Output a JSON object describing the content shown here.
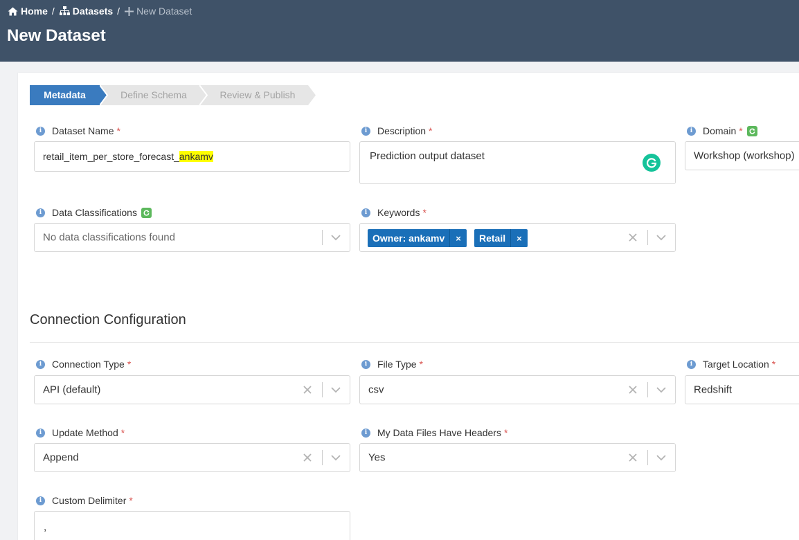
{
  "breadcrumb": {
    "home": "Home",
    "datasets": "Datasets",
    "current": "New Dataset",
    "separator": "/"
  },
  "page_title": "New Dataset",
  "wizard": {
    "steps": [
      {
        "label": "Metadata",
        "active": true
      },
      {
        "label": "Define Schema",
        "active": false
      },
      {
        "label": "Review & Publish",
        "active": false
      }
    ]
  },
  "fields": {
    "dataset_name": {
      "label": "Dataset Name",
      "value_plain": "retail_item_per_store_forecast_",
      "value_highlight": "ankamv"
    },
    "description": {
      "label": "Description",
      "value": "Prediction output dataset"
    },
    "domain": {
      "label": "Domain",
      "value": "Workshop (workshop)"
    },
    "data_classifications": {
      "label": "Data Classifications",
      "placeholder": "No data classifications found"
    },
    "keywords": {
      "label": "Keywords",
      "tags": [
        "Owner: ankamv",
        "Retail"
      ],
      "tag_remove": "×"
    },
    "connection_type": {
      "label": "Connection Type",
      "value": "API (default)"
    },
    "file_type": {
      "label": "File Type",
      "value": "csv"
    },
    "target_location": {
      "label": "Target Location",
      "value": "Redshift"
    },
    "update_method": {
      "label": "Update Method",
      "value": "Append"
    },
    "headers": {
      "label": "My Data Files Have Headers",
      "value": "Yes"
    },
    "custom_delimiter": {
      "label": "Custom Delimiter",
      "value": ","
    }
  },
  "required_marker": "*",
  "info_glyph": "i",
  "section": {
    "connection_title": "Connection Configuration"
  },
  "colors": {
    "header_bg": "#3f5268",
    "active_step": "#3a7bbf",
    "tag_bg": "#1a6fb8",
    "required": "#d9534f",
    "highlight": "#ffff00",
    "refresh_green": "#5cb85c"
  },
  "icons": {
    "home": "home-icon",
    "datasets": "sitemap-icon",
    "new": "plus-icon",
    "info": "info-circle-icon",
    "refresh": "refresh-icon",
    "clear": "close-icon",
    "dropdown": "chevron-down-icon",
    "grammarly": "grammarly-icon"
  }
}
